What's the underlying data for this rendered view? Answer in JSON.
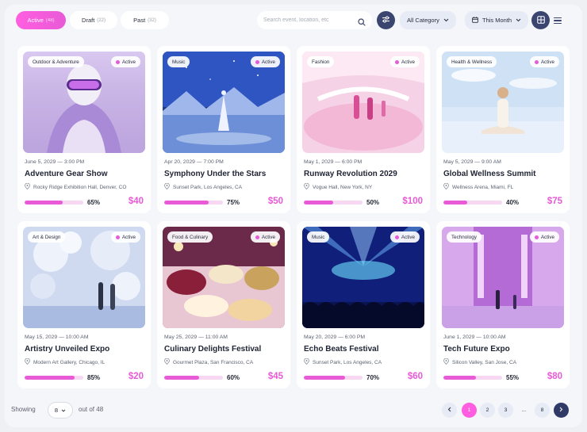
{
  "tabs": [
    {
      "label": "Active",
      "count": "(48)"
    },
    {
      "label": "Draft",
      "count": "(22)"
    },
    {
      "label": "Past",
      "count": "(32)"
    }
  ],
  "search": {
    "placeholder": "Search event, location, etc"
  },
  "category_filter": {
    "label": "All Category"
  },
  "date_filter": {
    "label": "This Month"
  },
  "events": [
    {
      "category": "Outdoor & Adventure",
      "status": "Active",
      "date": "June 5, 2029 — 3:00 PM",
      "title": "Adventure Gear Show",
      "location": "Rocky Ridge Exhibition Hall, Denver, CO",
      "progress": 65,
      "progress_label": "65%",
      "price": "$40"
    },
    {
      "category": "Music",
      "status": "Active",
      "date": "Apr 20, 2029 — 7:00 PM",
      "title": "Symphony Under the Stars",
      "location": "Sunset Park, Los Angeles, CA",
      "progress": 75,
      "progress_label": "75%",
      "price": "$50"
    },
    {
      "category": "Fashion",
      "status": "Active",
      "date": "May 1, 2029 — 6:00 PM",
      "title": "Runway Revolution 2029",
      "location": "Vogue Hall, New York, NY",
      "progress": 50,
      "progress_label": "50%",
      "price": "$100"
    },
    {
      "category": "Health & Wellness",
      "status": "Active",
      "date": "May 5, 2029 — 9:00 AM",
      "title": "Global Wellness Summit",
      "location": "Wellness Arena, Miami, FL",
      "progress": 40,
      "progress_label": "40%",
      "price": "$75"
    },
    {
      "category": "Art & Design",
      "status": "Active",
      "date": "May 15, 2029 — 10:00 AM",
      "title": "Artistry Unveiled Expo",
      "location": "Modern Art Gallery, Chicago, IL",
      "progress": 85,
      "progress_label": "85%",
      "price": "$20"
    },
    {
      "category": "Food & Culinary",
      "status": "Active",
      "date": "May 25, 2029 — 11:00 AM",
      "title": "Culinary Delights Festival",
      "location": "Gourmet Plaza, San Francisco, CA",
      "progress": 60,
      "progress_label": "60%",
      "price": "$45"
    },
    {
      "category": "Music",
      "status": "Active",
      "date": "May 20, 2029 — 6:00 PM",
      "title": "Echo Beats Festival",
      "location": "Sunset Park, Los Angeles, CA",
      "progress": 70,
      "progress_label": "70%",
      "price": "$60"
    },
    {
      "category": "Technology",
      "status": "Active",
      "date": "June 1, 2029 — 10:00 AM",
      "title": "Tech Future Expo",
      "location": "Silicon Valley, San Jose, CA",
      "progress": 55,
      "progress_label": "55%",
      "price": "$80"
    }
  ],
  "footer": {
    "showing_label": "Showing",
    "page_size": "8",
    "out_of_label": "out of 48"
  },
  "pagination": {
    "pages": [
      "1",
      "2",
      "3",
      "...",
      "8"
    ],
    "current": "1"
  },
  "colors": {
    "accent": "#e85ad6",
    "accent_light": "#f7d7f2",
    "navy": "#3b4670",
    "icon_names": [
      "search-icon",
      "sliders-icon",
      "chevron-down-icon",
      "calendar-icon",
      "grid-icon",
      "list-icon",
      "location-pin-icon",
      "chevron-left-icon",
      "chevron-right-icon"
    ]
  }
}
